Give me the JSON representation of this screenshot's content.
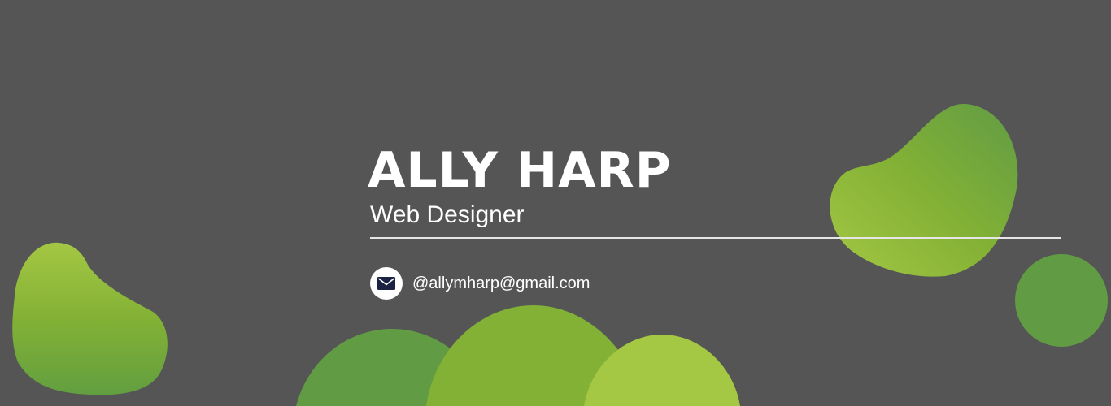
{
  "profile": {
    "name": "ALLY HARP",
    "title": "Web Designer",
    "email": "@allymharp@gmail.com"
  },
  "icons": {
    "contact": "envelope-icon"
  },
  "colors": {
    "background": "#555555",
    "text": "#ffffff",
    "divider": "#e6e6e6",
    "green_light": "#a4c744",
    "green_mid": "#83b135",
    "green_dark": "#619c45",
    "icon_navy": "#1c2244"
  }
}
